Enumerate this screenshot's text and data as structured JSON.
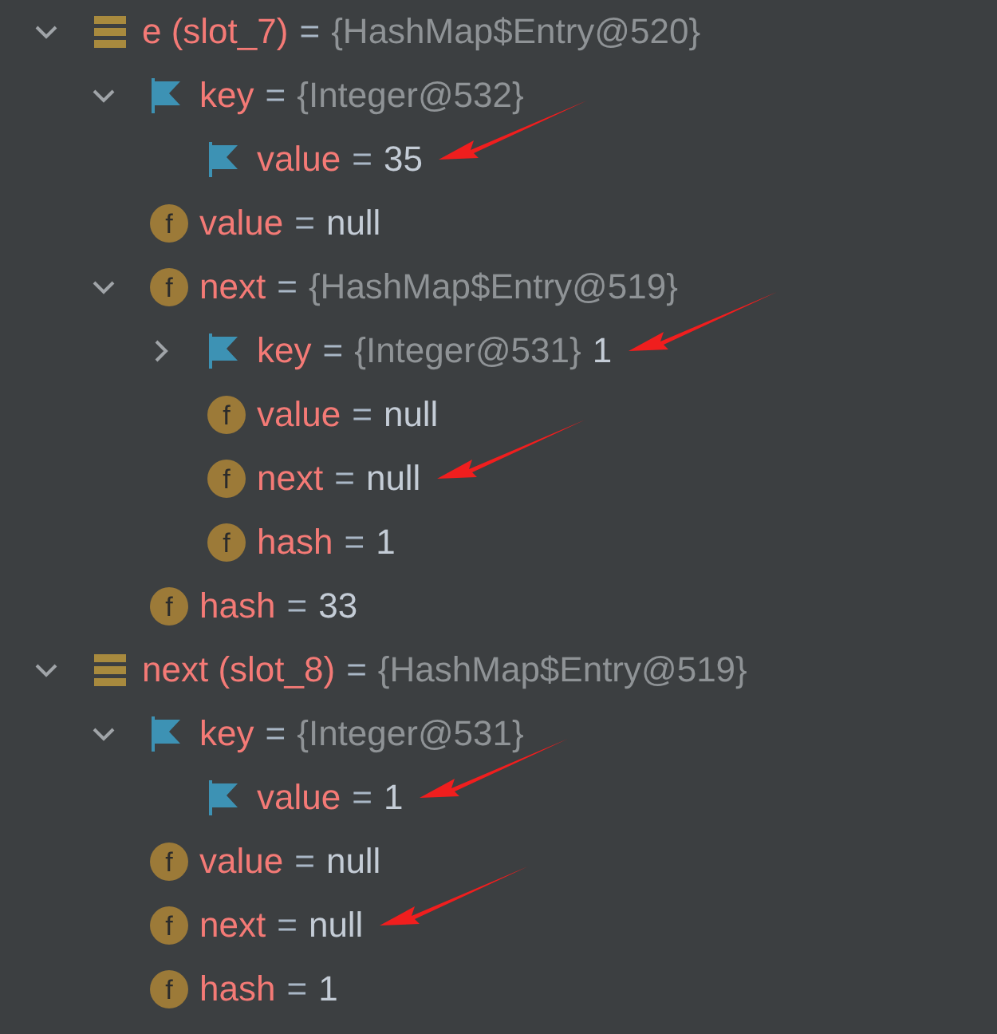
{
  "variables": [
    {
      "kind": "local",
      "name": "e (slot_7)",
      "operator": "=",
      "ref": "{HashMap$Entry@520}",
      "expanded": true,
      "annotated": false,
      "children": [
        {
          "kind": "flag",
          "name": "key",
          "operator": "=",
          "ref": "{Integer@532}",
          "expanded": true,
          "annotated": false,
          "children": [
            {
              "kind": "flag",
              "name": "value",
              "operator": "=",
              "value": "35",
              "annotated": true
            }
          ]
        },
        {
          "kind": "field",
          "icon_text": "f",
          "name": "value",
          "operator": "=",
          "value": "null",
          "annotated": false
        },
        {
          "kind": "field",
          "icon_text": "f",
          "name": "next",
          "operator": "=",
          "ref": "{HashMap$Entry@519}",
          "expanded": true,
          "annotated": false,
          "children": [
            {
              "kind": "flag",
              "name": "key",
              "operator": "=",
              "ref": "{Integer@531}",
              "value": "1",
              "expanded": false,
              "annotated": true
            },
            {
              "kind": "field",
              "icon_text": "f",
              "name": "value",
              "operator": "=",
              "value": "null",
              "annotated": false
            },
            {
              "kind": "field",
              "icon_text": "f",
              "name": "next",
              "operator": "=",
              "value": "null",
              "annotated": true
            },
            {
              "kind": "field",
              "icon_text": "f",
              "name": "hash",
              "operator": "=",
              "value": "1",
              "annotated": false
            }
          ]
        },
        {
          "kind": "field",
          "icon_text": "f",
          "name": "hash",
          "operator": "=",
          "value": "33",
          "annotated": false
        }
      ]
    },
    {
      "kind": "local",
      "name": "next (slot_8)",
      "operator": "=",
      "ref": "{HashMap$Entry@519}",
      "expanded": true,
      "annotated": false,
      "children": [
        {
          "kind": "flag",
          "name": "key",
          "operator": "=",
          "ref": "{Integer@531}",
          "expanded": true,
          "annotated": false,
          "children": [
            {
              "kind": "flag",
              "name": "value",
              "operator": "=",
              "value": "1",
              "annotated": true
            }
          ]
        },
        {
          "kind": "field",
          "icon_text": "f",
          "name": "value",
          "operator": "=",
          "value": "null",
          "annotated": false
        },
        {
          "kind": "field",
          "icon_text": "f",
          "name": "next",
          "operator": "=",
          "value": "null",
          "annotated": true
        },
        {
          "kind": "field",
          "icon_text": "f",
          "name": "hash",
          "operator": "=",
          "value": "1",
          "annotated": false
        }
      ]
    }
  ]
}
